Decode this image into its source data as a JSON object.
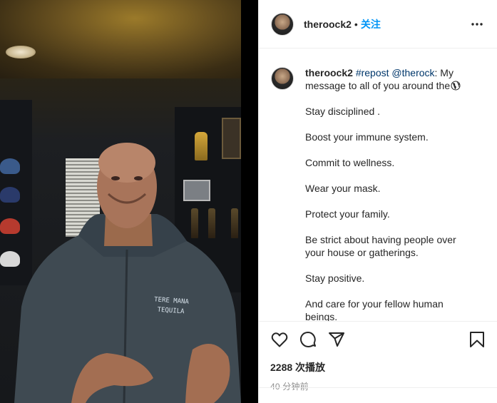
{
  "post": {
    "author": "theroock2",
    "follow_label": "关注",
    "separator": "•"
  },
  "caption": {
    "username": "theroock2",
    "hashtag": "#repost",
    "mention": "@therock",
    "intro": ": My message to all of you around the",
    "lines": [
      "Stay disciplined .",
      "Boost your immune system.",
      "Commit to wellness.",
      "Wear your mask.",
      "Protect your family.",
      "Be strict about having people over your house or gatherings.",
      "Stay positive.",
      "And care for your fellow human beings."
    ]
  },
  "video": {
    "hoodie_text_line1": "TERE MANA",
    "hoodie_text_line2": "TEQUILA"
  },
  "stats": {
    "views": "2288 次播放",
    "time": "40 分钟前"
  },
  "icons": [
    "more-icon",
    "globe-icon",
    "heart-icon",
    "comment-icon",
    "share-icon",
    "bookmark-icon"
  ]
}
